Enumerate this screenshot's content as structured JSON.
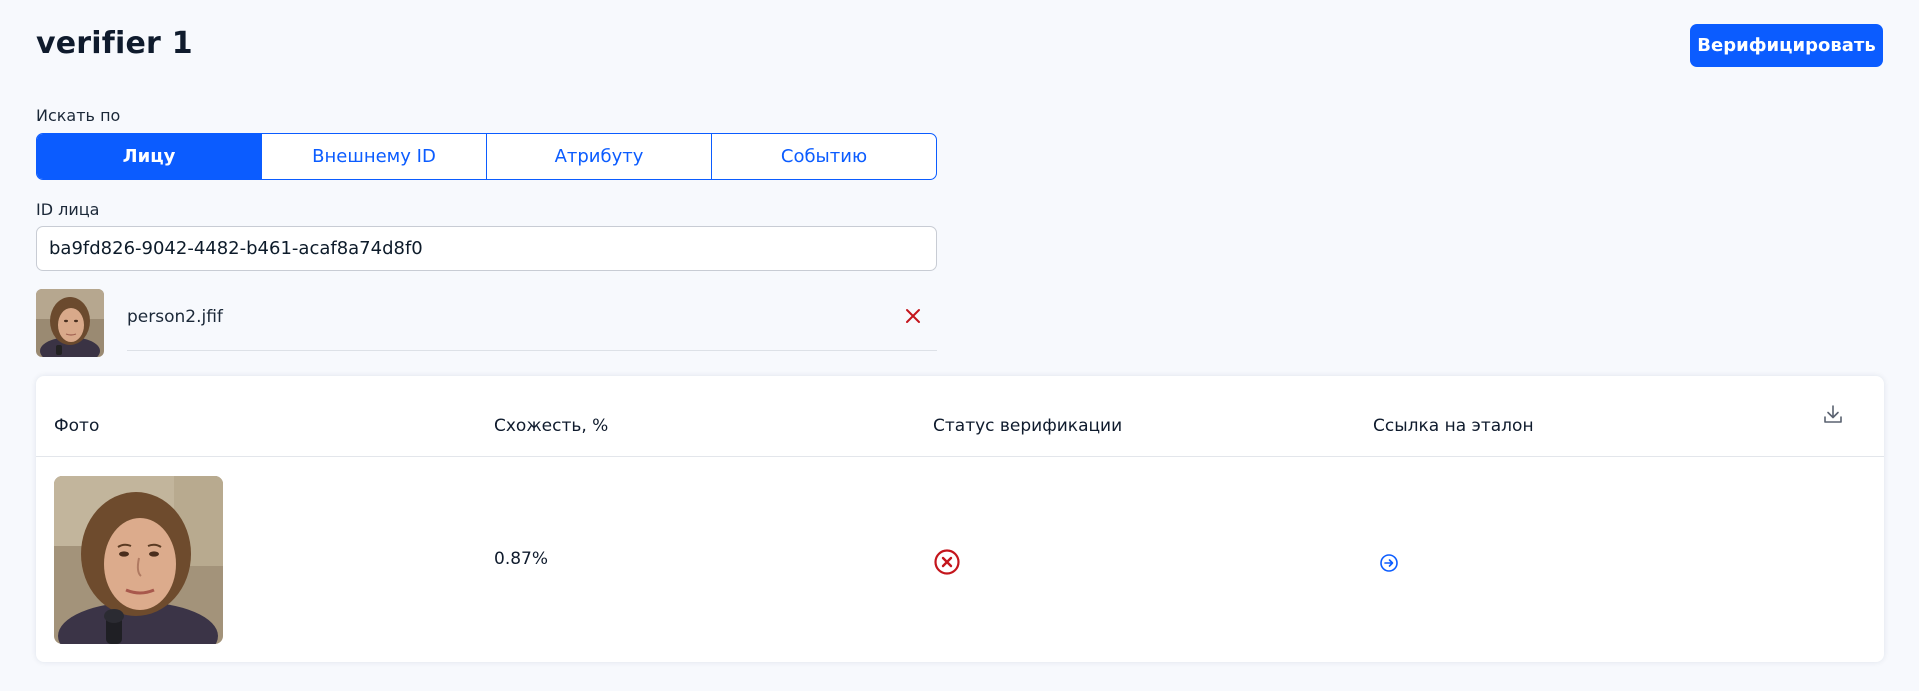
{
  "header": {
    "title": "verifier 1",
    "verify_label": "Верифицировать"
  },
  "search": {
    "label": "Искать по",
    "tabs": [
      {
        "label": "Лицу",
        "active": true
      },
      {
        "label": "Внешнему ID",
        "active": false
      },
      {
        "label": "Атрибуту",
        "active": false
      },
      {
        "label": "Событию",
        "active": false
      }
    ]
  },
  "face_id": {
    "label": "ID лица",
    "value": "ba9fd826-9042-4482-b461-acaf8a74d8f0"
  },
  "file": {
    "name": "person2.jfif"
  },
  "table": {
    "columns": [
      "Фото",
      "Схожесть, %",
      "Статус верификации",
      "Ссылка на эталон"
    ],
    "rows": [
      {
        "similarity": "0.87%"
      }
    ]
  },
  "colors": {
    "accent": "#0b5cff",
    "error": "#c4151c",
    "background": "#f7f9fd"
  },
  "icons": {
    "remove": "close-icon",
    "download": "download-icon",
    "status": "status-failed-icon",
    "link": "arrow-right-circle-icon"
  }
}
